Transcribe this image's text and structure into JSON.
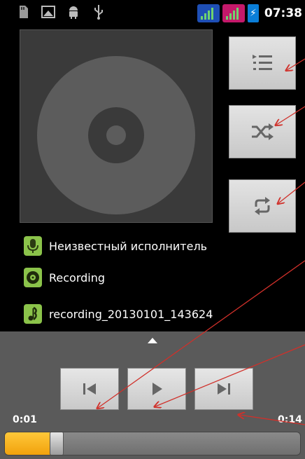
{
  "status_bar": {
    "time": "07:38",
    "icons": [
      "sd-card-icon",
      "screenshot-icon",
      "android-debug-icon",
      "usb-icon"
    ],
    "signal_colors": [
      "#1e4fb5",
      "#c4196a"
    ]
  },
  "album_art": {
    "icon": "cd-disc-icon"
  },
  "side_buttons": {
    "playlist": {
      "icon": "playlist-icon"
    },
    "shuffle": {
      "icon": "shuffle-icon"
    },
    "repeat": {
      "icon": "repeat-icon"
    }
  },
  "track": {
    "artist": "Неизвестный исполнитель",
    "album": "Recording",
    "title": "recording_20130101_143624"
  },
  "playback": {
    "elapsed": "0:01",
    "duration": "0:14",
    "progress_fraction": 0.071
  },
  "colors": {
    "accent_green": "#8bc34a",
    "seek_fill": "#f5b21a",
    "annotation_arrow": "#d0302a"
  }
}
